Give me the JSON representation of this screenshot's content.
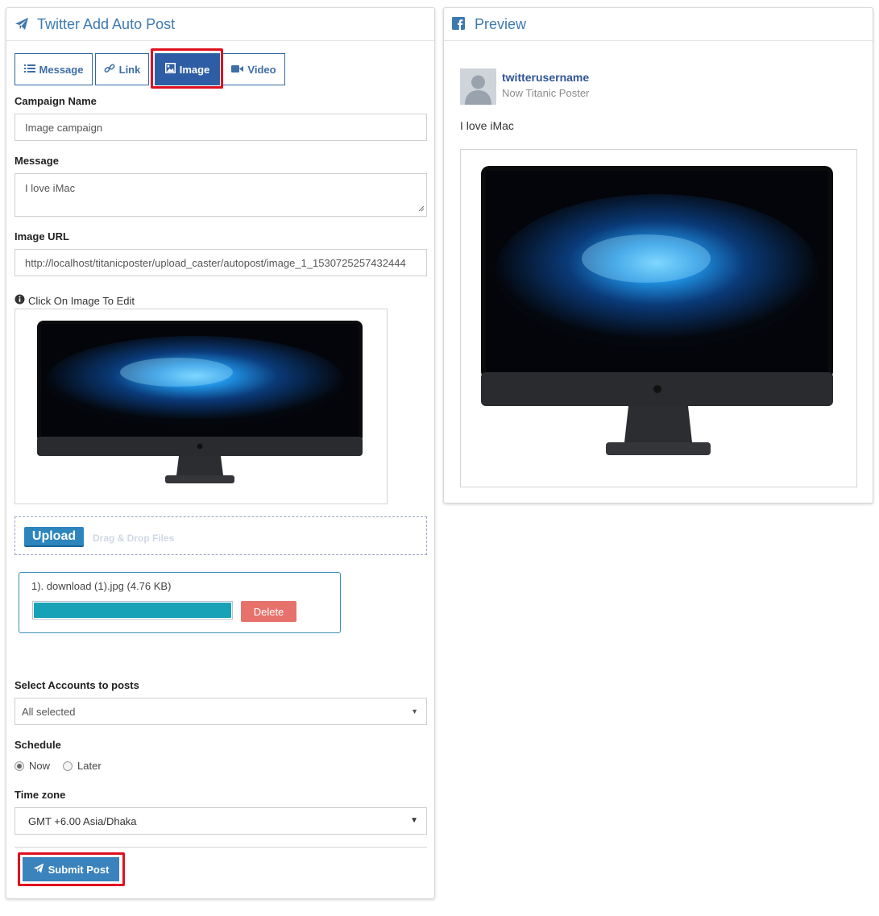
{
  "left_panel": {
    "title": "Twitter Add Auto Post",
    "title_icon": "paper-plane-icon",
    "tabs": [
      {
        "label": "Message",
        "icon": "list-icon",
        "active": false
      },
      {
        "label": "Link",
        "icon": "link-icon",
        "active": false
      },
      {
        "label": "Image",
        "icon": "image-icon",
        "active": true
      },
      {
        "label": "Video",
        "icon": "video-icon",
        "active": false
      }
    ],
    "campaign_name": {
      "label": "Campaign Name",
      "value": "Image campaign"
    },
    "message": {
      "label": "Message",
      "value": "I love iMac"
    },
    "image_url": {
      "label": "Image URL",
      "value": "http://localhost/titanicposter/upload_caster/autopost/image_1_1530725257432444"
    },
    "image_hint": "Click On Image To Edit",
    "upload": {
      "button_label": "Upload",
      "dropzone_text": "Drag & Drop Files",
      "file_name": "1). download (1).jpg (4.76 KB)",
      "progress": 1.0,
      "delete_label": "Delete"
    },
    "accounts": {
      "label": "Select Accounts to posts",
      "value": "All selected"
    },
    "schedule": {
      "label": "Schedule",
      "options": [
        {
          "label": "Now",
          "checked": true
        },
        {
          "label": "Later",
          "checked": false
        }
      ]
    },
    "timezone": {
      "label": "Time zone",
      "value": "GMT +6.00 Asia/Dhaka"
    },
    "submit_label": "Submit Post"
  },
  "preview_panel": {
    "title": "Preview",
    "title_icon": "facebook-icon",
    "username": "twitterusername",
    "subtitle": "Now Titanic Poster",
    "message": "I love iMac"
  },
  "colors": {
    "accent": "#3d7ab0",
    "active_tab": "#2d5ea5",
    "highlight": "#e0101f",
    "progress": "#17a2b8",
    "delete": "#e7726c",
    "submit": "#3a83bd"
  }
}
